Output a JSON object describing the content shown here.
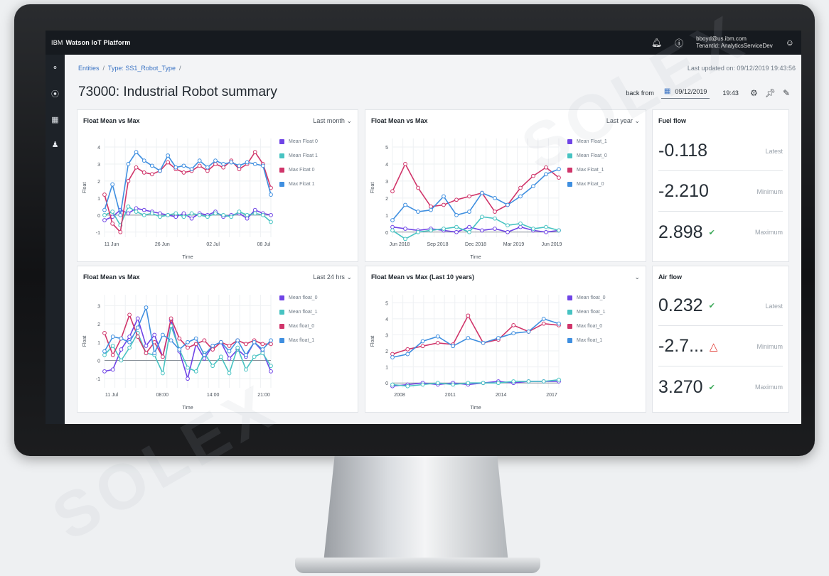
{
  "topbar": {
    "ibm": "IBM",
    "app_title": "Watson IoT Platform",
    "user_email": "bboyd@us.ibm.com",
    "tenant": "TenantId: AnalyticsServiceDev"
  },
  "breadcrumb": {
    "entities": "Entities",
    "sep1": "/",
    "type": "Type: SS1_Robot_Type",
    "sep2": "/"
  },
  "last_updated": "Last updated on: 09/12/2019 19:43:56",
  "page_title": "73000: Industrial Robot summary",
  "controls": {
    "back_from": "back from",
    "date": "09/12/2019",
    "time": "19:43"
  },
  "watermark": "SOLEX",
  "cards": {
    "c1": {
      "title": "Float Mean vs Max",
      "range": "Last month"
    },
    "c2": {
      "title": "Float Mean vs Max",
      "range": "Last year"
    },
    "c3": {
      "title": "Float Mean vs Max",
      "range": "Last 24 hrs"
    },
    "c4": {
      "title": "Float Mean vs Max (Last 10 years)",
      "range": ""
    }
  },
  "fuel_flow": {
    "title": "Fuel flow",
    "rows": [
      {
        "value": "-0.118",
        "label": "Latest"
      },
      {
        "value": "-2.210",
        "label": "Minimum"
      },
      {
        "value": "2.898",
        "label": "Maximum"
      }
    ]
  },
  "air_flow": {
    "title": "Air flow",
    "rows": [
      {
        "value": "0.232",
        "label": "Latest"
      },
      {
        "value": "-2.7...",
        "label": "Minimum"
      },
      {
        "value": "3.270",
        "label": "Maximum"
      }
    ]
  },
  "colors": {
    "purple": "#6f44e6",
    "teal": "#47c3c2",
    "pink": "#d0356a",
    "blue": "#3f8fe0"
  },
  "chart_data": [
    {
      "type": "line",
      "title": "Float Mean vs Max",
      "xlabel": "Time",
      "ylabel": "Float",
      "x_ticks": [
        "11 Jun",
        "26 Jun",
        "02 Jul",
        "08 Jul"
      ],
      "y_ticks": [
        -1,
        0,
        1,
        2,
        3,
        4
      ],
      "ylim": [
        -1.3,
        4.5
      ],
      "series": [
        {
          "name": "Mean Float 0",
          "color": "#6f44e6",
          "values": [
            -0.3,
            -0.1,
            0.3,
            0.1,
            0.4,
            0.3,
            0.2,
            0.1,
            0.0,
            -0.1,
            0.1,
            -0.2,
            0.1,
            0.0,
            0.2,
            -0.1,
            0.0,
            0.1,
            -0.2,
            0.3,
            0.1,
            0.0
          ]
        },
        {
          "name": "Mean Float 1",
          "color": "#47c3c2",
          "values": [
            0.0,
            0.2,
            -0.6,
            0.5,
            0.2,
            0.0,
            0.1,
            -0.1,
            0.0,
            0.1,
            -0.1,
            0.1,
            0.0,
            -0.1,
            0.1,
            0.0,
            -0.1,
            0.2,
            0.0,
            0.1,
            0.0,
            -0.4
          ]
        },
        {
          "name": "Max Float 0",
          "color": "#d0356a",
          "values": [
            1.2,
            -0.5,
            -1.0,
            2.0,
            2.8,
            2.5,
            2.4,
            2.6,
            3.1,
            2.7,
            2.5,
            2.6,
            2.9,
            2.6,
            3.0,
            2.8,
            3.2,
            2.7,
            3.0,
            3.7,
            3.0,
            1.6
          ]
        },
        {
          "name": "Max Float 1",
          "color": "#3f8fe0",
          "values": [
            0.3,
            1.8,
            0.0,
            3.0,
            3.7,
            3.2,
            2.9,
            2.6,
            3.5,
            2.8,
            2.9,
            2.7,
            3.2,
            2.8,
            3.2,
            3.0,
            3.1,
            2.9,
            3.1,
            3.0,
            2.9,
            1.2
          ]
        }
      ]
    },
    {
      "type": "line",
      "title": "Float Mean vs Max",
      "xlabel": "Time",
      "ylabel": "Float",
      "x_ticks": [
        "Jun 2018",
        "Sep 2018",
        "Dec 2018",
        "Mar 2019",
        "Jun 2019"
      ],
      "y_ticks": [
        0,
        1,
        2,
        3,
        4,
        5
      ],
      "ylim": [
        -0.3,
        5.5
      ],
      "series": [
        {
          "name": "Mean Float_1",
          "color": "#6f44e6",
          "values": [
            0.3,
            0.2,
            0.1,
            0.2,
            0.1,
            0.0,
            0.3,
            0.1,
            0.2,
            0.0,
            0.3,
            0.1,
            0.0,
            0.1
          ]
        },
        {
          "name": "Mean Float_0",
          "color": "#47c3c2",
          "values": [
            0.1,
            -0.4,
            0.0,
            0.1,
            0.2,
            0.3,
            0.0,
            0.9,
            0.8,
            0.4,
            0.5,
            0.2,
            0.3,
            0.1
          ]
        },
        {
          "name": "Max Float_1",
          "color": "#d0356a",
          "values": [
            2.4,
            4.0,
            2.6,
            1.5,
            1.6,
            1.9,
            2.1,
            2.3,
            1.2,
            1.6,
            2.6,
            3.3,
            3.8,
            3.2
          ]
        },
        {
          "name": "Max Float_0",
          "color": "#3f8fe0",
          "values": [
            0.7,
            1.6,
            1.2,
            1.3,
            2.1,
            1.0,
            1.2,
            2.3,
            2.0,
            1.6,
            2.1,
            2.7,
            3.4,
            3.7
          ]
        }
      ]
    },
    {
      "type": "line",
      "title": "Float Mean vs Max",
      "xlabel": "Time",
      "ylabel": "Float",
      "x_ticks": [
        "11 Jul",
        "08:00",
        "14:00",
        "21:00"
      ],
      "y_ticks": [
        -1,
        0,
        1,
        2,
        3
      ],
      "ylim": [
        -1.5,
        3.6
      ],
      "series": [
        {
          "name": "Mean float_0",
          "color": "#6f44e6",
          "values": [
            -0.6,
            -0.5,
            0.6,
            1.3,
            2.3,
            0.8,
            1.4,
            0.2,
            2.2,
            0.5,
            -1.0,
            0.9,
            0.1,
            0.8,
            1.0,
            0.1,
            0.6,
            0.2,
            1.0,
            0.5,
            -0.6
          ]
        },
        {
          "name": "Mean float_1",
          "color": "#47c3c2",
          "values": [
            0.3,
            0.8,
            0.0,
            0.7,
            1.5,
            0.4,
            0.3,
            -0.7,
            1.9,
            0.6,
            -0.4,
            -0.6,
            0.4,
            -0.3,
            0.2,
            -0.7,
            0.7,
            -0.5,
            0.2,
            0.4,
            -0.3
          ]
        },
        {
          "name": "Max float_0",
          "color": "#d0356a",
          "values": [
            1.5,
            0.3,
            1.2,
            2.5,
            1.3,
            0.4,
            1.0,
            0.2,
            2.3,
            1.2,
            0.7,
            0.9,
            1.1,
            0.6,
            1.0,
            0.8,
            1.1,
            0.9,
            1.1,
            0.9,
            0.9
          ]
        },
        {
          "name": "Max float_1",
          "color": "#3f8fe0",
          "values": [
            0.5,
            1.3,
            1.2,
            1.0,
            1.8,
            2.9,
            0.4,
            1.4,
            1.1,
            0.6,
            1.0,
            1.2,
            0.3,
            0.8,
            1.0,
            0.5,
            1.1,
            0.3,
            1.0,
            0.6,
            1.1
          ]
        }
      ]
    },
    {
      "type": "line",
      "title": "Float Mean vs Max (Last 10 years)",
      "xlabel": "Time",
      "ylabel": "Float",
      "x_ticks": [
        "2008",
        "2011",
        "2014",
        "2017"
      ],
      "y_ticks": [
        0,
        1,
        2,
        3,
        4,
        5
      ],
      "ylim": [
        -0.3,
        5.5
      ],
      "series": [
        {
          "name": "Mean float_0",
          "color": "#6f44e6",
          "values": [
            -0.2,
            -0.1,
            0.0,
            -0.1,
            0.0,
            -0.1,
            0.0,
            0.1,
            0.0,
            0.1,
            0.1,
            0.1
          ]
        },
        {
          "name": "Mean float_1",
          "color": "#47c3c2",
          "values": [
            -0.1,
            -0.2,
            -0.1,
            0.0,
            -0.1,
            0.0,
            0.0,
            0.0,
            0.1,
            0.1,
            0.1,
            0.2
          ]
        },
        {
          "name": "Max float_0",
          "color": "#d0356a",
          "values": [
            1.8,
            2.1,
            2.3,
            2.5,
            2.4,
            4.2,
            2.5,
            2.7,
            3.6,
            3.2,
            3.7,
            3.6
          ]
        },
        {
          "name": "Max float_1",
          "color": "#3f8fe0",
          "values": [
            1.6,
            1.8,
            2.6,
            2.9,
            2.3,
            2.8,
            2.5,
            2.8,
            3.1,
            3.2,
            4.0,
            3.7
          ]
        }
      ]
    }
  ]
}
